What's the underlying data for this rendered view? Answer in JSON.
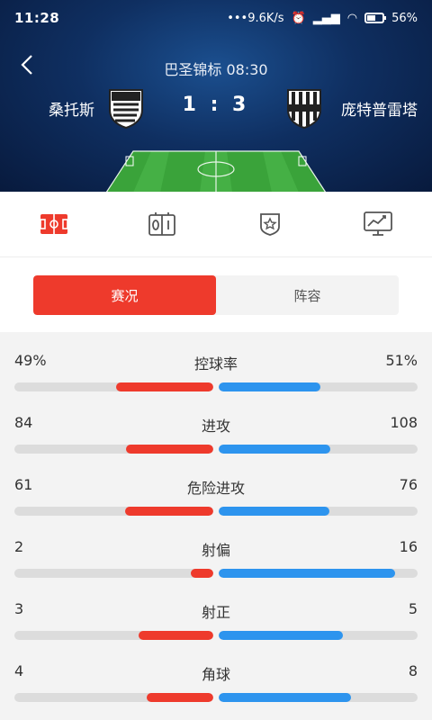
{
  "status_bar": {
    "time": "11:28",
    "net_speed": "9.6K/s",
    "battery": "56%",
    "battery_level": 0.56
  },
  "match": {
    "league_time": "巴圣锦标 08:30",
    "home_team": "桑托斯",
    "away_team": "庞特普雷塔",
    "score": "1 : 3"
  },
  "icon_tabs": [
    {
      "icon": "pitch-icon",
      "active": true
    },
    {
      "icon": "scoreboard-icon",
      "active": false
    },
    {
      "icon": "badge-star-icon",
      "active": false
    },
    {
      "icon": "chart-monitor-icon",
      "active": false
    }
  ],
  "segments": [
    {
      "label": "赛况",
      "active": true
    },
    {
      "label": "阵容",
      "active": false
    }
  ],
  "colors": {
    "home": "#ee3a2c",
    "away": "#2d94ee",
    "track": "#dcdcdc"
  },
  "stats": [
    {
      "name": "控球率",
      "home": "49%",
      "away": "51%",
      "home_val": 49,
      "away_val": 51
    },
    {
      "name": "进攻",
      "home": "84",
      "away": "108",
      "home_val": 84,
      "away_val": 108
    },
    {
      "name": "危险进攻",
      "home": "61",
      "away": "76",
      "home_val": 61,
      "away_val": 76
    },
    {
      "name": "射偏",
      "home": "2",
      "away": "16",
      "home_val": 2,
      "away_val": 16
    },
    {
      "name": "射正",
      "home": "3",
      "away": "5",
      "home_val": 3,
      "away_val": 5
    },
    {
      "name": "角球",
      "home": "4",
      "away": "8",
      "home_val": 4,
      "away_val": 8
    }
  ]
}
